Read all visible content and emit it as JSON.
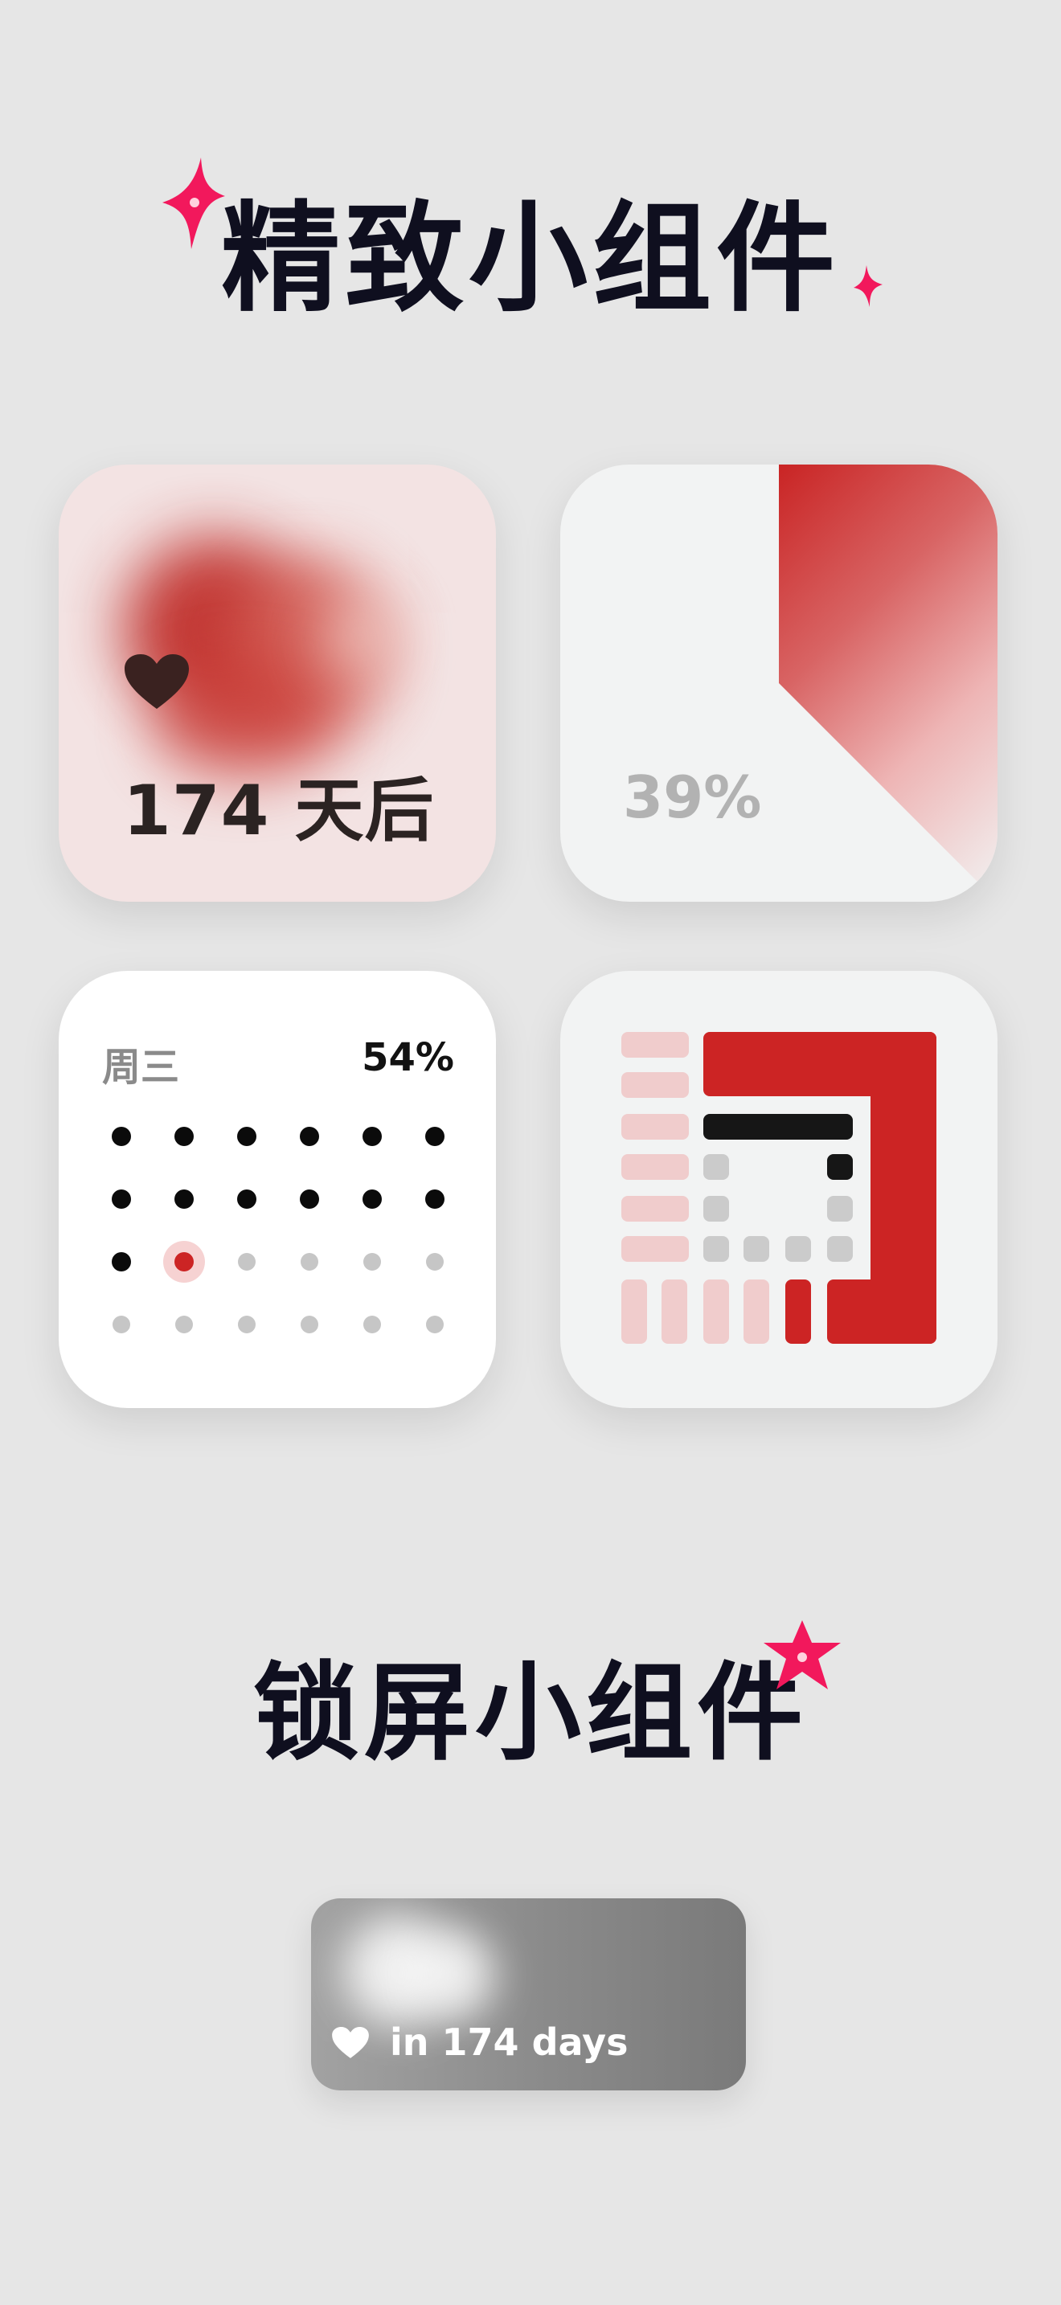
{
  "sections": {
    "home_title": "精致小组件",
    "lock_title": "锁屏小组件"
  },
  "widgets": {
    "countdown": {
      "value": "174 天后",
      "icon": "heart-icon"
    },
    "progress": {
      "value": "39%",
      "fraction": 0.39
    },
    "calendar": {
      "weekday": "周三",
      "percent": "54%",
      "days_total": 24,
      "days_elapsed": 13,
      "current_day": 14
    },
    "grid": {
      "icon": "calendar-grid-icon"
    },
    "lockscreen": {
      "text": "in 174 days",
      "icon": "heart-icon"
    }
  },
  "colors": {
    "accent": "#cc2424",
    "sparkle": "#f2185c",
    "title": "#0f0f1f",
    "background": "#e6e6e6"
  }
}
